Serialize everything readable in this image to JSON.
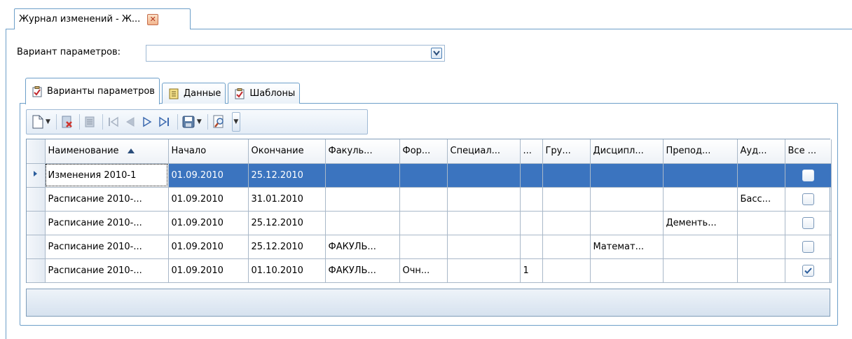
{
  "doc_tab": {
    "title": "Журнал изменений - Ж..."
  },
  "params": {
    "label": "Вариант параметров:",
    "value": ""
  },
  "tabs": [
    {
      "label": "Варианты параметров",
      "icon": "checklist-icon",
      "active": true
    },
    {
      "label": "Данные",
      "icon": "document-icon",
      "active": false
    },
    {
      "label": "Шаблоны",
      "icon": "checklist-icon",
      "active": false
    }
  ],
  "toolbar": {
    "buttons": [
      "new-icon",
      "delete-icon",
      "copy-icon",
      "first-icon",
      "prev-icon",
      "next-icon",
      "last-icon",
      "save-icon",
      "preview-icon"
    ]
  },
  "grid": {
    "columns": [
      "Наименование",
      "Начало",
      "Окончание",
      "Факуль...",
      "Фор...",
      "Специал...",
      "...",
      "Гру...",
      "Дисципл...",
      "Препод...",
      "Ауд...",
      "Все ..."
    ],
    "rows": [
      {
        "name": "Изменения 2010-1",
        "start": "01.09.2010",
        "end": "25.12.2010",
        "fac": "",
        "form": "",
        "spec": "",
        "c": "",
        "grp": "",
        "disc": "",
        "teacher": "",
        "aud": "",
        "all": false,
        "selected": true
      },
      {
        "name": "Расписание 2010-...",
        "start": "01.09.2010",
        "end": "31.01.2010",
        "fac": "",
        "form": "",
        "spec": "",
        "c": "",
        "grp": "",
        "disc": "",
        "teacher": "",
        "aud": "Басс...",
        "all": false,
        "selected": false
      },
      {
        "name": "Расписание 2010-...",
        "start": "01.09.2010",
        "end": "25.12.2010",
        "fac": "",
        "form": "",
        "spec": "",
        "c": "",
        "grp": "",
        "disc": "",
        "teacher": "Дементь...",
        "aud": "",
        "all": false,
        "selected": false
      },
      {
        "name": "Расписание 2010-...",
        "start": "01.09.2010",
        "end": "25.12.2010",
        "fac": "ФАКУЛЬ...",
        "form": "",
        "spec": "",
        "c": "",
        "grp": "",
        "disc": "Математ...",
        "teacher": "",
        "aud": "",
        "all": false,
        "selected": false
      },
      {
        "name": "Расписание 2010-...",
        "start": "01.09.2010",
        "end": "01.10.2010",
        "fac": "ФАКУЛЬ...",
        "form": "Очн...",
        "spec": "",
        "c": "1",
        "grp": "",
        "disc": "",
        "teacher": "",
        "aud": "",
        "all": true,
        "selected": false
      }
    ]
  },
  "colors": {
    "accent": "#3b74bf",
    "border": "#6d9fc9"
  }
}
